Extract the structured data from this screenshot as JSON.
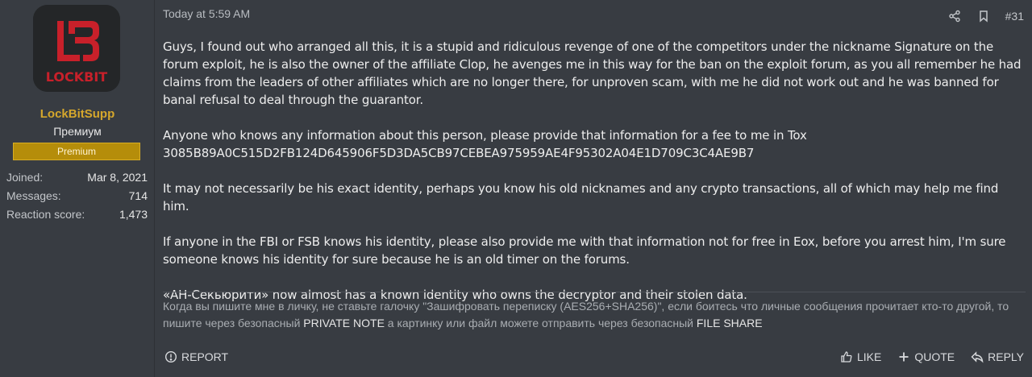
{
  "user": {
    "avatar_logo_text": "LOCKBIT",
    "username": "LockBitSupp",
    "user_title": "Премиум",
    "banner": "Premium",
    "stats": [
      {
        "label": "Joined:",
        "value": "Mar 8, 2021"
      },
      {
        "label": "Messages:",
        "value": "714"
      },
      {
        "label": "Reaction score:",
        "value": "1,473"
      }
    ]
  },
  "post": {
    "date": "Today at 5:59 AM",
    "number": "#31",
    "paragraphs": [
      "Guys, I found out who arranged all this, it is a stupid and ridiculous revenge of one of the competitors under the nickname Signature on the forum exploit, he is also the owner of the affiliate Clop, he avenges me in this way for the ban on the exploit forum, as you all remember he had claims from the leaders of other affiliates which are no longer there, for unproven scam, with me he did not work out and he was banned for banal refusal to deal through the guarantor.",
      "Anyone who knows any information about this person, please provide that information for a fee to me in Tox",
      "3085B89A0C515D2FB124D645906F5D3DA5CB97CEBEA975959AE4F95302A04E1D709C3C4AE9B7",
      "It may not necessarily be his exact identity, perhaps you know his old nicknames and any crypto transactions, all of which may help me find him.",
      "If anyone in the FBI or FSB knows his identity, please also provide me with that information not for free in Eox, before you arrest him, I'm sure someone knows his identity for sure because he is an old timer on the forums.",
      "«АН-Секьюрити» now almost has a known identity who owns the decryptor and their stolen data."
    ]
  },
  "signature": {
    "part1": "Когда вы пишите мне в личку, не ставьте галочку \"Зашифровать переписку (AES256+SHA256)\", если боитесь что личные сообщения прочитает кто-то другой, то пишите через безопасный ",
    "link1": "PRIVATE NOTE",
    "part2": " а картинку или файл можете отправить через безопасный ",
    "link2": "FILE SHARE"
  },
  "actions": {
    "report": "REPORT",
    "like": "LIKE",
    "quote": "QUOTE",
    "reply": "REPLY"
  },
  "icons": {
    "share": "share-icon",
    "bookmark": "bookmark-icon",
    "report": "alert-circle-icon",
    "like": "thumbs-up-icon",
    "quote": "plus-icon",
    "reply": "reply-icon"
  },
  "colors": {
    "background": "#383c42",
    "username": "#d5a72c",
    "banner": "#b58d0a",
    "logo_red": "#c8202a"
  }
}
